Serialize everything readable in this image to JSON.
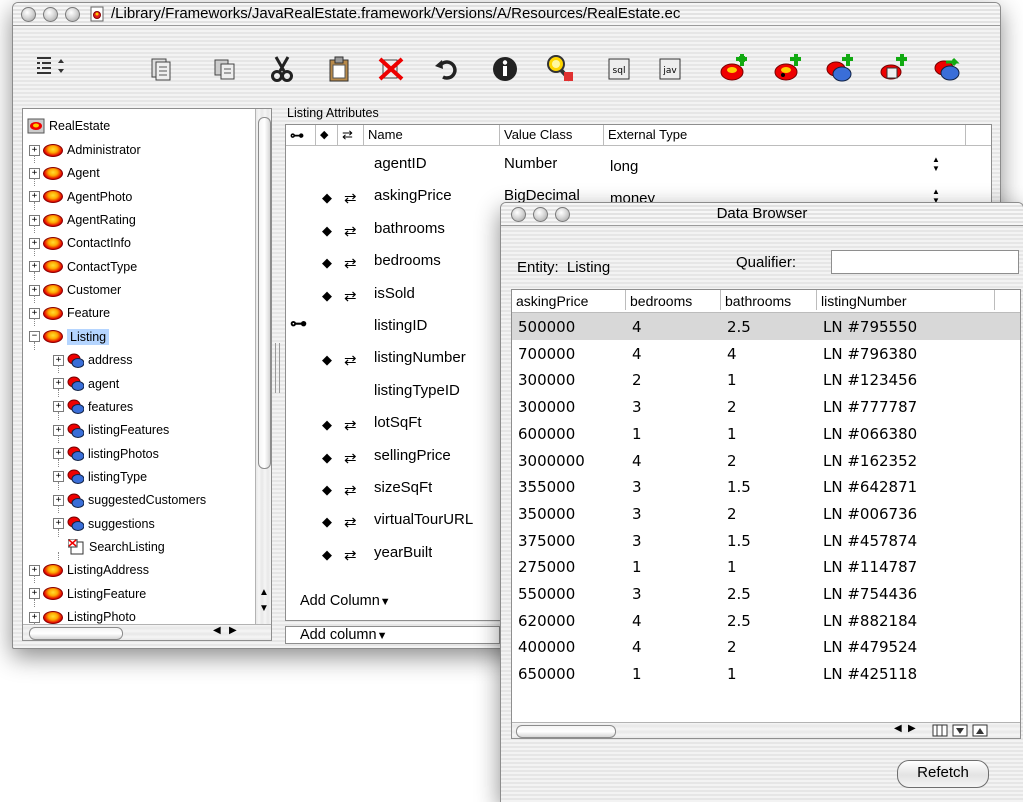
{
  "main_window": {
    "title": "/Library/Frameworks/JavaRealEstate.framework/Versions/A/Resources/RealEstate.ec"
  },
  "toolbar": {
    "icons": [
      "outline-view-icon",
      "copy-entity-icon",
      "copy-icon",
      "cut-icon",
      "paste-icon",
      "delete-icon",
      "undo-icon",
      "info-icon",
      "search-icon",
      "sql-icon",
      "java-icon",
      "add-entity-icon",
      "add-attribute-icon",
      "add-relationship-icon",
      "add-fetch-spec-icon",
      "flatten-icon"
    ],
    "sql_label": "sql",
    "jav_label": "jav"
  },
  "tree": {
    "root": "RealEstate",
    "items": [
      {
        "label": "Administrator",
        "type": "entity",
        "expander": "+"
      },
      {
        "label": "Agent",
        "type": "entity",
        "expander": "+"
      },
      {
        "label": "AgentPhoto",
        "type": "entity",
        "expander": "+"
      },
      {
        "label": "AgentRating",
        "type": "entity",
        "expander": "+"
      },
      {
        "label": "ContactInfo",
        "type": "entity",
        "expander": "+"
      },
      {
        "label": "ContactType",
        "type": "entity",
        "expander": "+"
      },
      {
        "label": "Customer",
        "type": "entity",
        "expander": "+"
      },
      {
        "label": "Feature",
        "type": "entity",
        "expander": "+"
      },
      {
        "label": "Listing",
        "type": "entity",
        "expander": "−",
        "selected": true
      },
      {
        "label": "address",
        "type": "relationship",
        "expander": "+"
      },
      {
        "label": "agent",
        "type": "relationship",
        "expander": "+"
      },
      {
        "label": "features",
        "type": "relationship",
        "expander": "+"
      },
      {
        "label": "listingFeatures",
        "type": "relationship",
        "expander": "+"
      },
      {
        "label": "listingPhotos",
        "type": "relationship",
        "expander": "+"
      },
      {
        "label": "listingType",
        "type": "relationship",
        "expander": "+"
      },
      {
        "label": "suggestedCustomers",
        "type": "relationship",
        "expander": "+"
      },
      {
        "label": "suggestions",
        "type": "relationship",
        "expander": "+"
      },
      {
        "label": "SearchListing",
        "type": "fetchspec",
        "expander": ""
      },
      {
        "label": "ListingAddress",
        "type": "entity",
        "expander": "+"
      },
      {
        "label": "ListingFeature",
        "type": "entity",
        "expander": "+"
      },
      {
        "label": "ListingPhoto",
        "type": "entity",
        "expander": "+"
      }
    ]
  },
  "attributes": {
    "section_title": "Listing Attributes",
    "columns": {
      "key": "⊶",
      "lock": "◆",
      "sync": "⇄",
      "name": "Name",
      "value_class": "Value Class",
      "external_type": "External Type"
    },
    "rows": [
      {
        "key": false,
        "lock": false,
        "sync": false,
        "name": "agentID",
        "value_class": "Number",
        "external_type": "long",
        "has_stepper": true
      },
      {
        "key": false,
        "lock": true,
        "sync": true,
        "name": "askingPrice",
        "value_class": "BigDecimal",
        "external_type": "money",
        "has_stepper": true
      },
      {
        "key": false,
        "lock": true,
        "sync": true,
        "name": "bathrooms",
        "value_class": "",
        "external_type": "",
        "has_stepper": false
      },
      {
        "key": false,
        "lock": true,
        "sync": true,
        "name": "bedrooms",
        "value_class": "",
        "external_type": "",
        "has_stepper": false
      },
      {
        "key": false,
        "lock": true,
        "sync": true,
        "name": "isSold",
        "value_class": "",
        "external_type": "",
        "has_stepper": false
      },
      {
        "key": true,
        "lock": false,
        "sync": false,
        "name": "listingID",
        "value_class": "",
        "external_type": "",
        "has_stepper": false
      },
      {
        "key": false,
        "lock": true,
        "sync": true,
        "name": "listingNumber",
        "value_class": "",
        "external_type": "",
        "has_stepper": false
      },
      {
        "key": false,
        "lock": false,
        "sync": false,
        "name": "listingTypeID",
        "value_class": "",
        "external_type": "",
        "has_stepper": false
      },
      {
        "key": false,
        "lock": true,
        "sync": true,
        "name": "lotSqFt",
        "value_class": "",
        "external_type": "",
        "has_stepper": false
      },
      {
        "key": false,
        "lock": true,
        "sync": true,
        "name": "sellingPrice",
        "value_class": "",
        "external_type": "",
        "has_stepper": false
      },
      {
        "key": false,
        "lock": true,
        "sync": true,
        "name": "sizeSqFt",
        "value_class": "",
        "external_type": "",
        "has_stepper": false
      },
      {
        "key": false,
        "lock": true,
        "sync": true,
        "name": "virtualTourURL",
        "value_class": "",
        "external_type": "",
        "has_stepper": false
      },
      {
        "key": false,
        "lock": true,
        "sync": true,
        "name": "yearBuilt",
        "value_class": "",
        "external_type": "",
        "has_stepper": false
      }
    ],
    "add_column_label": "Add Column",
    "add_column_lower_label": "Add column",
    "dropdown_glyph": "▼"
  },
  "data_browser": {
    "title": "Data Browser",
    "entity_label": "Entity:",
    "entity_value": "Listing",
    "qualifier_label": "Qualifier:",
    "qualifier_value": "",
    "columns": [
      "askingPrice",
      "bedrooms",
      "bathrooms",
      "listingNumber"
    ],
    "rows": [
      [
        "500000",
        "4",
        "2.5",
        "LN #795550"
      ],
      [
        "700000",
        "4",
        "4",
        "LN #796380"
      ],
      [
        "300000",
        "2",
        "1",
        "LN #123456"
      ],
      [
        "300000",
        "3",
        "2",
        "LN #777787"
      ],
      [
        "600000",
        "1",
        "1",
        "LN #066380"
      ],
      [
        "3000000",
        "4",
        "2",
        "LN #162352"
      ],
      [
        "355000",
        "3",
        "1.5",
        "LN #642871"
      ],
      [
        "350000",
        "3",
        "2",
        "LN #006736"
      ],
      [
        "375000",
        "3",
        "1.5",
        "LN #457874"
      ],
      [
        "275000",
        "1",
        "1",
        "LN #114787"
      ],
      [
        "550000",
        "3",
        "2.5",
        "LN #754436"
      ],
      [
        "620000",
        "4",
        "2.5",
        "LN #882184"
      ],
      [
        "400000",
        "4",
        "2",
        "LN #479524"
      ],
      [
        "650000",
        "1",
        "1",
        "LN #425118"
      ]
    ],
    "selected_row": 0,
    "refetch_label": "Refetch"
  }
}
